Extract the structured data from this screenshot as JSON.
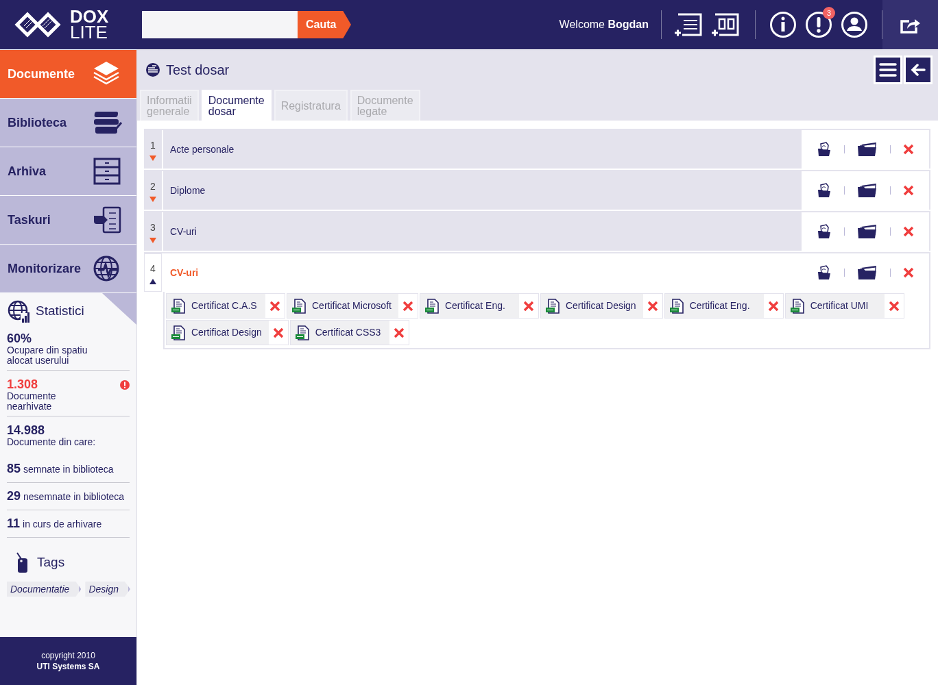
{
  "header": {
    "logo": {
      "line1": "DOX",
      "line2": "LITE"
    },
    "search": {
      "button": "Cauta"
    },
    "welcome": "Welcome **Bogdan**",
    "notifications": "3"
  },
  "sidebar": {
    "nav": [
      {
        "label": "Documente",
        "selected": true
      },
      {
        "label": "Biblioteca",
        "selected": false
      },
      {
        "label": "Arhiva",
        "selected": false
      },
      {
        "label": "Taskuri",
        "selected": false
      },
      {
        "label": "Monitorizare",
        "selected": false
      }
    ],
    "stats": {
      "title": "Statistici",
      "items": [
        {
          "kind": "block",
          "value": "60%",
          "label": "Ocupare din spatiu alocat userului",
          "alert": false
        },
        {
          "kind": "block",
          "value": "1.308",
          "label": "Documente nearhivate",
          "alert": true
        },
        {
          "kind": "block",
          "value": "14.988",
          "label": "Documente din care:",
          "alert": false
        },
        {
          "kind": "inline",
          "value": "85",
          "label": "semnate in biblioteca",
          "alert": false
        },
        {
          "kind": "inline",
          "value": "29",
          "label": "nesemnate in biblioteca",
          "alert": false
        },
        {
          "kind": "inline",
          "value": "11",
          "label": "in curs de arhivare",
          "alert": false
        }
      ]
    },
    "tags": {
      "title": "Tags",
      "items": [
        "Documentatie",
        "Design"
      ]
    },
    "footer": [
      "copyright 2010",
      "UTI Systems SA"
    ]
  },
  "main": {
    "title": "Test dosar",
    "tabs": [
      {
        "label": "Informatii\ngenerale",
        "selected": false
      },
      {
        "label": "Documente\ndosar",
        "selected": true
      },
      {
        "label": "Registratura",
        "selected": false
      },
      {
        "label": "Documente\nlegate",
        "selected": false
      }
    ],
    "rows": [
      {
        "number": "1",
        "name": "Acte personale",
        "expanded": false,
        "attachments": []
      },
      {
        "number": "2",
        "name": "Diplome",
        "expanded": false,
        "attachments": []
      },
      {
        "number": "3",
        "name": "CV-uri",
        "expanded": false,
        "attachments": []
      },
      {
        "number": "4",
        "name": "CV-uri",
        "expanded": true,
        "attachments": [
          "Certificat C.A.S",
          "Certificat Microsoft",
          "Certificat Eng.",
          "Certificat Design",
          "Certificat Eng.",
          "Certificat UMI",
          "Certificat Design",
          "Certificat CSS3"
        ]
      }
    ]
  }
}
